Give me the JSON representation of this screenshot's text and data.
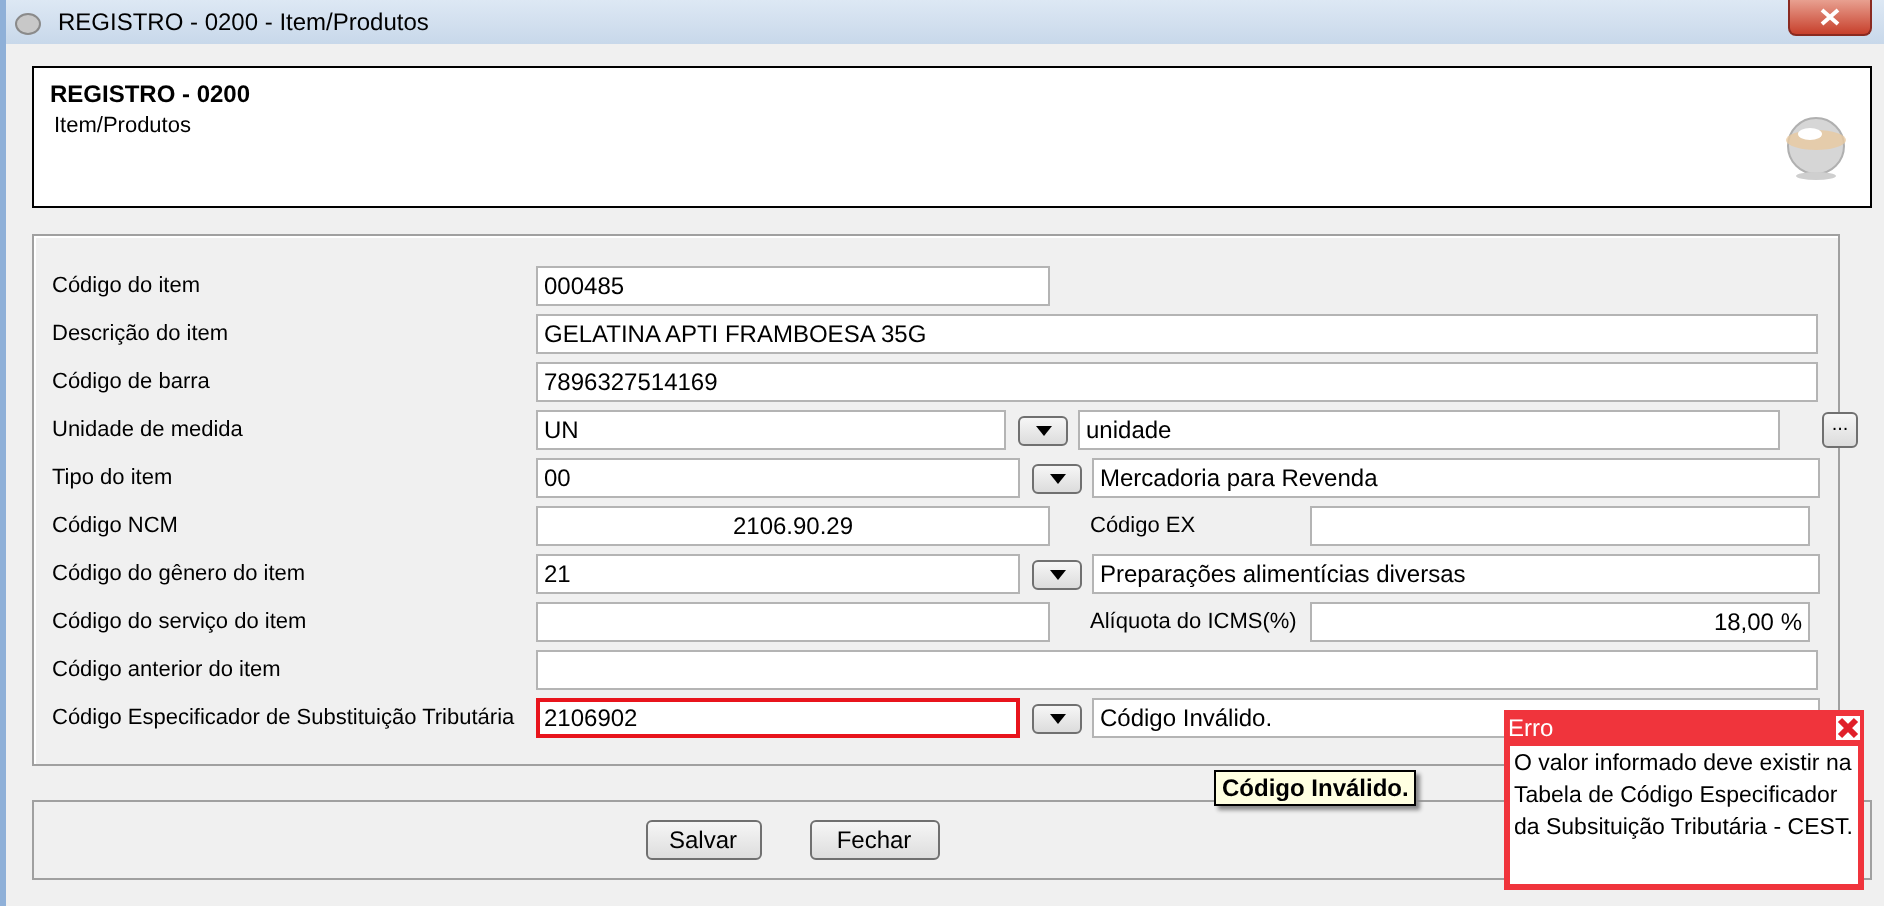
{
  "window": {
    "title": "REGISTRO - 0200 - Item/Produtos"
  },
  "header": {
    "title": "REGISTRO - 0200",
    "subtitle": "Item/Produtos"
  },
  "fields": [
    {
      "kind": "short",
      "label": "Código do item",
      "value": "000485",
      "error": false
    },
    {
      "kind": "wide",
      "label": "Descrição do item",
      "value": "GELATINA APTI FRAMBOESA 35G",
      "error": false
    },
    {
      "kind": "wide",
      "label": "Código de barra",
      "value": "7896327514169",
      "error": false
    },
    {
      "kind": "browse",
      "label": "Unidade de medida",
      "value": "UN",
      "description": "unidade",
      "browse_label": "...",
      "error": false
    },
    {
      "kind": "lookup",
      "label": "Tipo do item",
      "value": "00",
      "description": "Mercadoria para Revenda",
      "error": false
    },
    {
      "kind": "pair",
      "label": "Código NCM",
      "value": "2106.90.29",
      "side_label": "Código EX",
      "error": false
    },
    {
      "kind": "lookup",
      "label": "Código do gênero do item",
      "value": "21",
      "description": "Preparações alimentícias diversas",
      "error": false
    },
    {
      "kind": "pair",
      "label": "Código do serviço do item",
      "side_label": "Alíquota do ICMS(%)",
      "side_value": "18,00 %",
      "error": false
    },
    {
      "kind": "wide",
      "label": "Código anterior do item",
      "error": false
    },
    {
      "kind": "lookup",
      "label": "Código Especificador de Substituição Tributária",
      "value": "2106902",
      "description": "Código Inválido.",
      "error": true
    }
  ],
  "tooltip": "Código Inválido.",
  "error_popup": {
    "title": "Erro",
    "message": "O valor informado deve existir na Tabela de Código Especificador da Subsituição Tributária - CEST."
  },
  "buttons": [
    "Salvar",
    "Fechar"
  ]
}
